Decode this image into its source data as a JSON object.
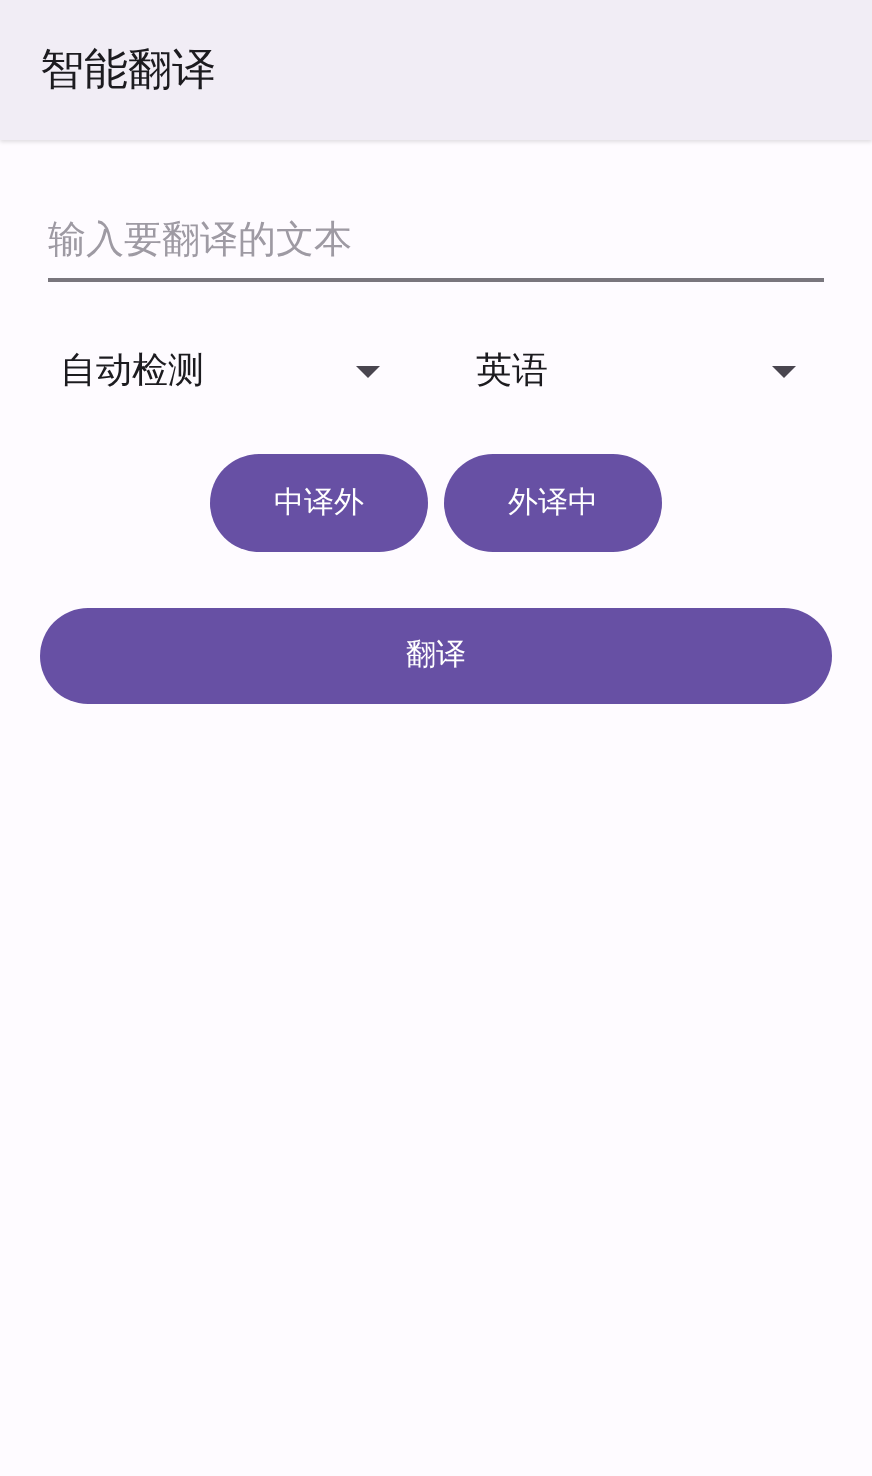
{
  "app_bar": {
    "title": "智能翻译"
  },
  "input": {
    "placeholder": "输入要翻译的文本"
  },
  "dropdowns": [
    {
      "value": "自动检测"
    },
    {
      "value": "英语"
    }
  ],
  "direction_buttons": [
    "中译外",
    "外译中"
  ],
  "translate_button": "翻译"
}
